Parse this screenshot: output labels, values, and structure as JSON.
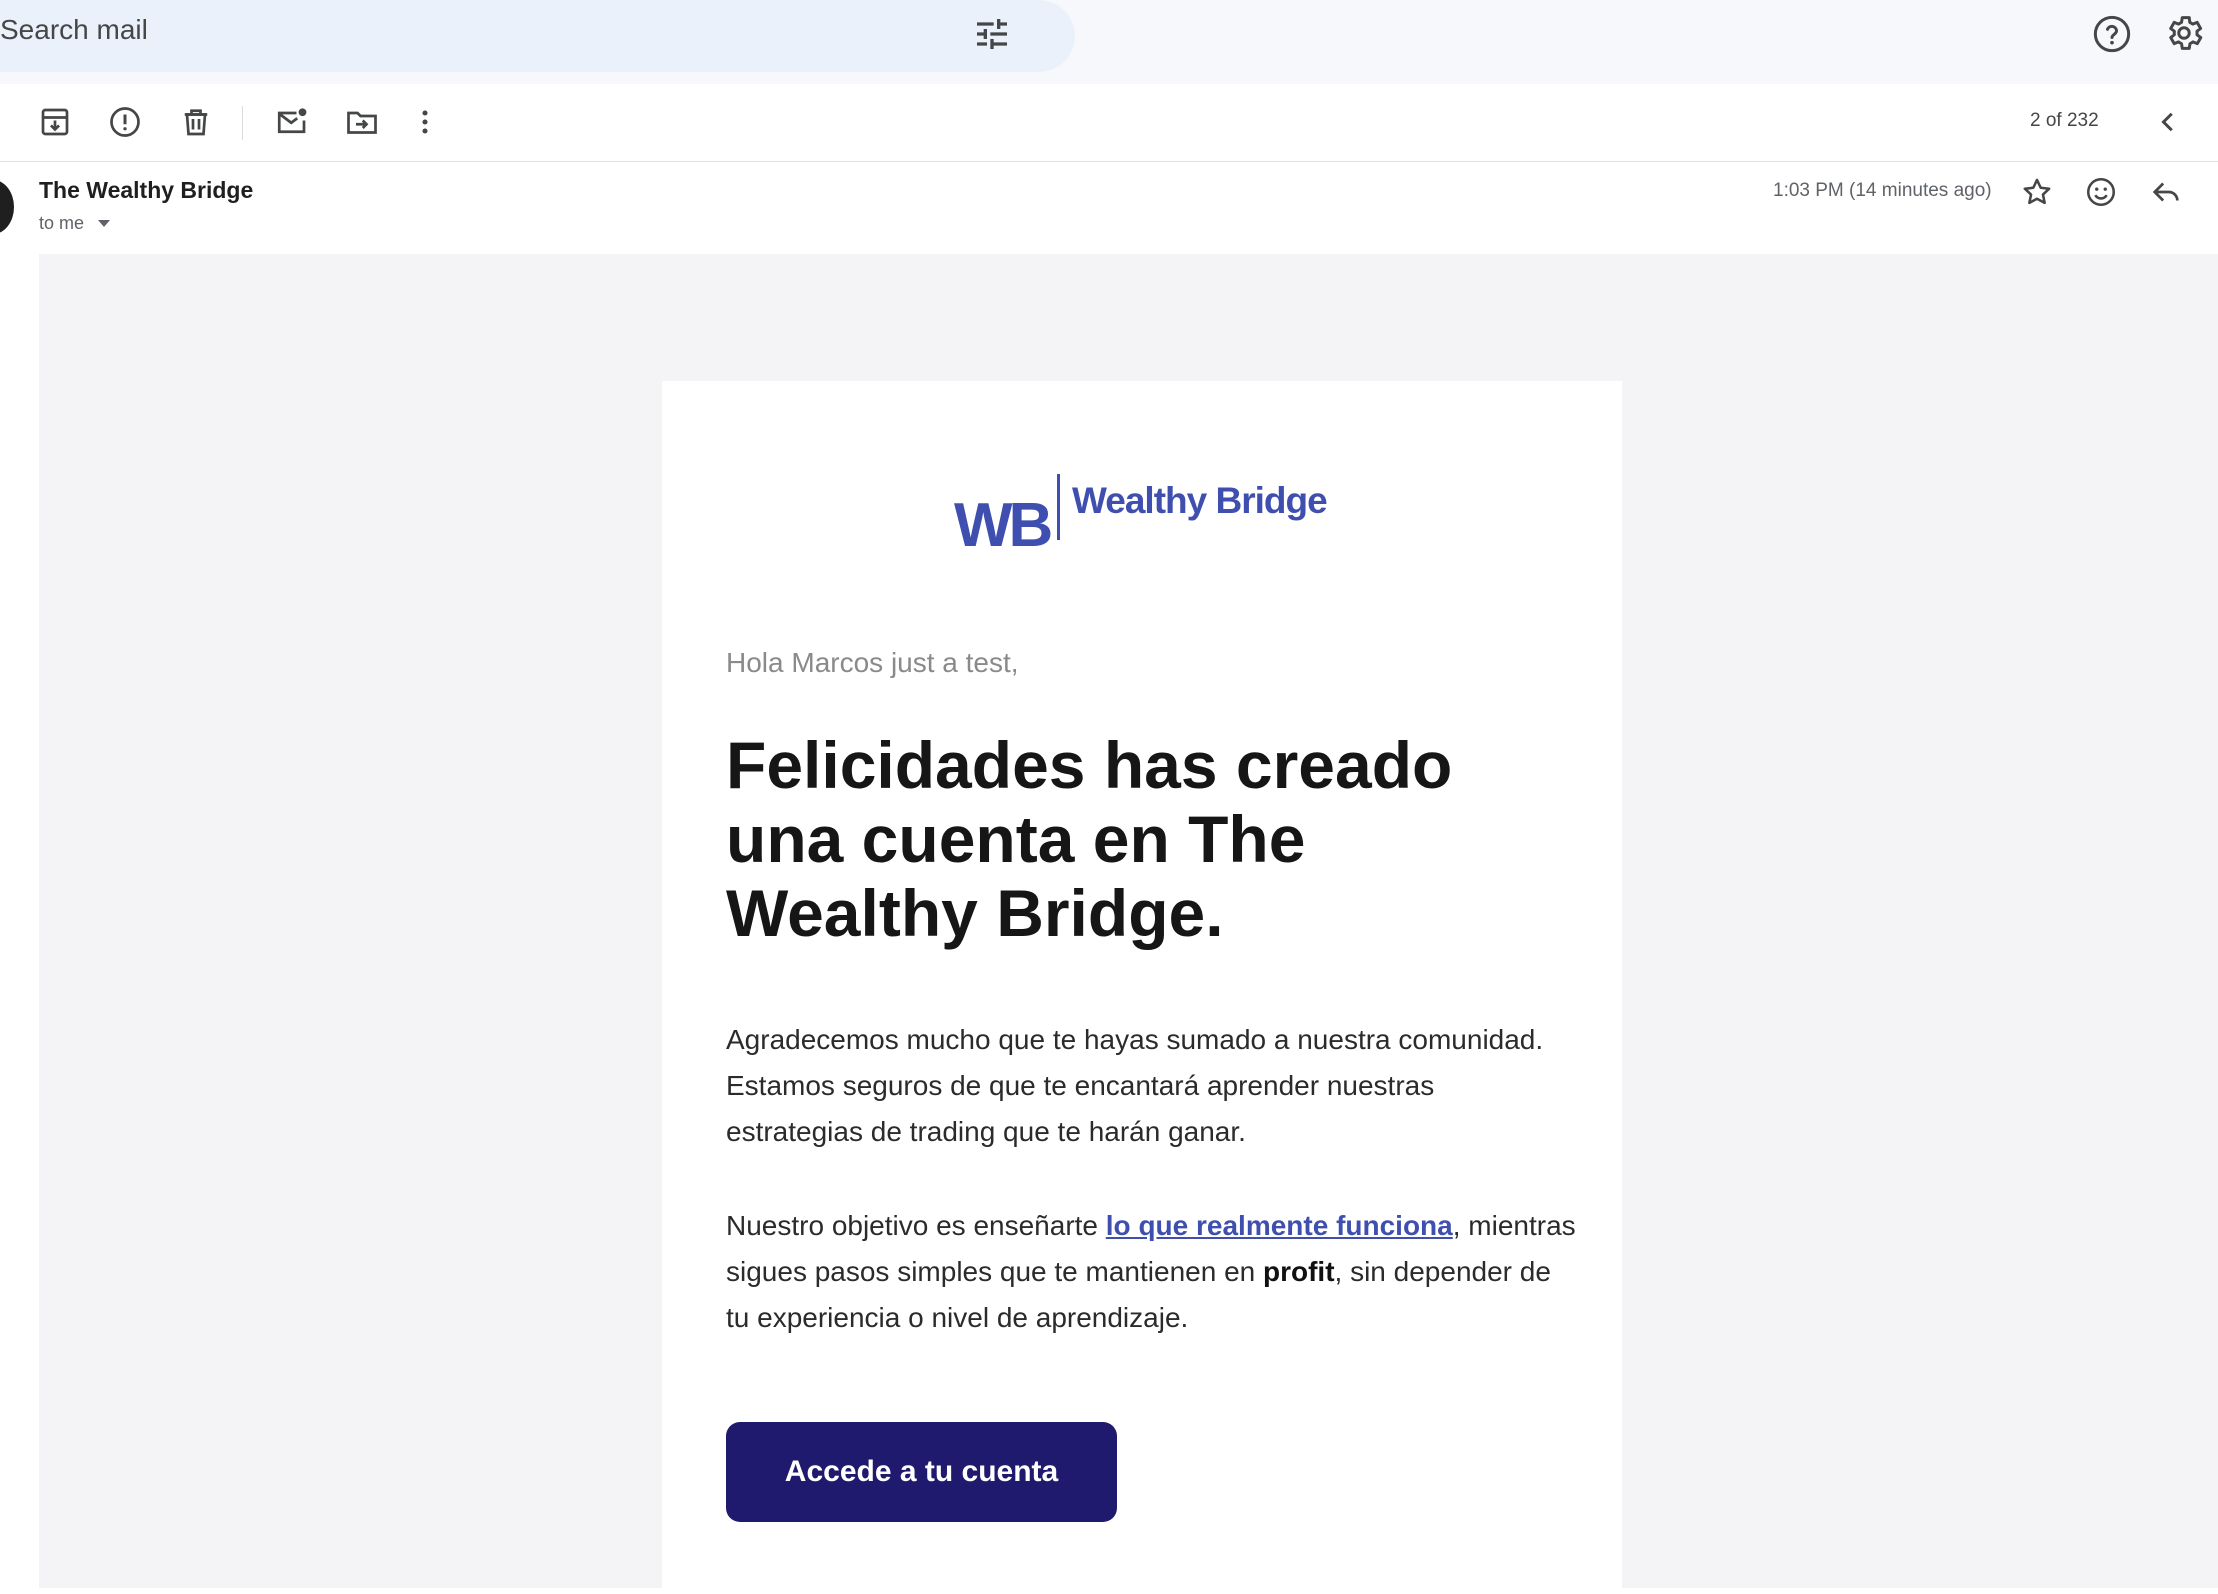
{
  "search": {
    "placeholder": "Search mail"
  },
  "toolbar": {
    "pager": "2 of 232"
  },
  "message": {
    "sender": "The Wealthy Bridge",
    "recipient": "to me",
    "time": "1:03 PM (14 minutes ago)"
  },
  "email": {
    "logo_mark": "WB",
    "logo_name": "Wealthy Bridge",
    "greeting": "Hola Marcos just a test,",
    "headline": "Felicidades has creado una cuenta en The Wealthy Bridge.",
    "paragraph1": "Agradecemos mucho que te hayas sumado a nuestra comunidad. Estamos seguros de que te encantará aprender nuestras estrategias de trading que te harán ganar.",
    "paragraph2_start": "Nuestro objetivo es enseñarte ",
    "paragraph2_link": "lo que realmente funciona",
    "paragraph2_mid": ", mientras sigues pasos simples que te mantienen en ",
    "paragraph2_bold": "profit",
    "paragraph2_end": ", sin depender de tu experiencia o nivel de aprendizaje.",
    "cta_label": "Accede a tu cuenta"
  },
  "colors": {
    "brand": "#3f4fb0",
    "cta_bg": "#1f1a6e",
    "page_bg": "#f4f4f6"
  },
  "icons": [
    "tune-icon",
    "help-icon",
    "gear-icon",
    "archive-icon",
    "report-spam-icon",
    "delete-icon",
    "mark-unread-icon",
    "move-to-icon",
    "more-vert-icon",
    "chevron-left-icon",
    "star-icon",
    "emoji-icon",
    "reply-icon"
  ]
}
